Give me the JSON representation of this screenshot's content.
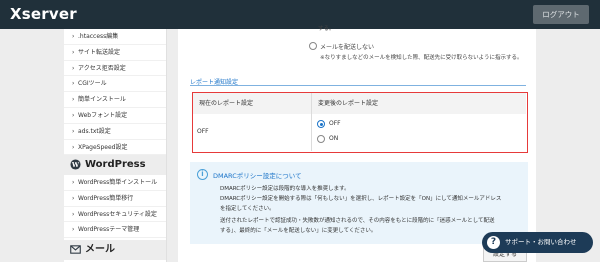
{
  "header": {
    "logo": "Xserver",
    "logout_label": "ログアウト"
  },
  "sidebar": {
    "items_top": [
      {
        "label": ".htaccess編集"
      },
      {
        "label": "サイト転送設定"
      },
      {
        "label": "アクセス拒否設定"
      },
      {
        "label": "CGIツール"
      },
      {
        "label": "簡単インストール"
      },
      {
        "label": "Webフォント設定"
      },
      {
        "label": "ads.txt設定"
      },
      {
        "label": "XPageSpeed設定"
      }
    ],
    "wordpress_heading": "WordPress",
    "items_wp": [
      {
        "label": "WordPress簡単インストール"
      },
      {
        "label": "WordPress簡単移行"
      },
      {
        "label": "WordPressセキュリティ設定"
      },
      {
        "label": "WordPressテーマ管理"
      }
    ],
    "mail_heading": "メール"
  },
  "main": {
    "top_fragment_1": "する。",
    "top_option_label": "メールを配送しない",
    "top_option_note": "※なりすましなどのメールを検知した際、配送先に受け取らないように指示する。",
    "section_title": "レポート通知設定",
    "table": {
      "col_current": "現在のレポート設定",
      "col_after": "変更後のレポート設定",
      "current_value": "OFF",
      "options": [
        "OFF",
        "ON"
      ],
      "selected": "OFF"
    },
    "info": {
      "title": "DMARCポリシー設定について",
      "lines": [
        "DMARCポリシー設定は段階的な導入を推奨します。",
        "DMARCポリシー設定を開始する際は「何もしない」を選択し、レポート設定を「ON」にして通知メールアドレス",
        "を指定してください。",
        "送付されたレポートで認証成功・失敗数が通知されるので、その内容をもとに段階的に「迷惑メールとして配送",
        "する」、最終的に「メールを配送しない」に変更してください。"
      ]
    },
    "save_label": "設定する"
  },
  "support": {
    "label": "サポート・お問い合わせ"
  }
}
